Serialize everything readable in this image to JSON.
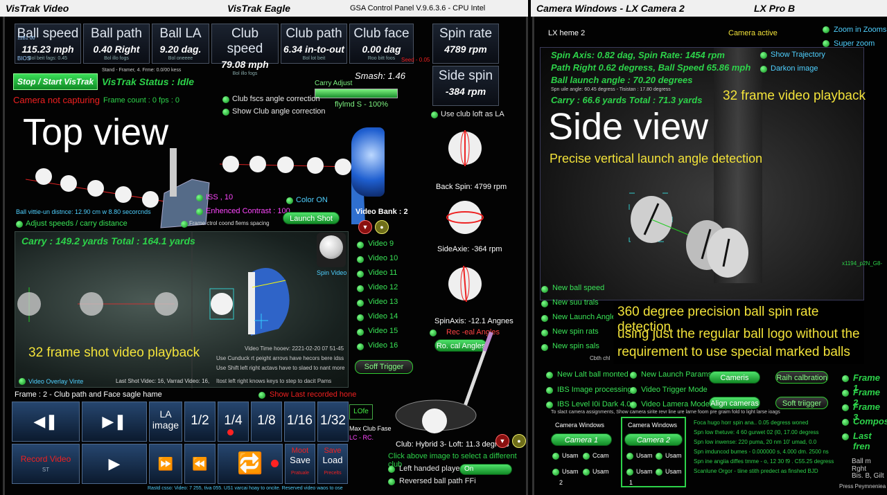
{
  "left_window": {
    "title": "VisTrak Video",
    "center_title": "VisTrak Eagle",
    "panel_title": "GSA Control Panel  V.9.6.3.6 - CPU Intel"
  },
  "right_window": {
    "title": "Camera Windows - LX Camera 2",
    "center_title": "LX Pro B"
  },
  "metrics": [
    {
      "label": "Ball speed",
      "value": "115.23 mph",
      "sub": "Bol beit fags: 0.45"
    },
    {
      "label": "Ball path",
      "value": "0.40 Right",
      "sub": "Bol illo fogs"
    },
    {
      "label": "Ball LA",
      "value": "9.20 dag.",
      "sub": "Bol oneeee"
    },
    {
      "label": "Club speed",
      "value": "79.08 mph",
      "sub": "Bol illo fogs"
    },
    {
      "label": "Club path",
      "value": "6.34 in-to-out",
      "sub": "Bol lot beit"
    },
    {
      "label": "Club face",
      "value": "0.00 dag",
      "sub": "Roo bitt foos"
    }
  ],
  "metric_extra": {
    "top_left_small": "11B1 00",
    "bios": "BIOS",
    "seed": "Seed - 0.05"
  },
  "spin": {
    "rate_label": "Spin rate",
    "rate_value": "4789 rpm",
    "side_label": "Side spin",
    "side_value": "-384 rpm"
  },
  "vistrak": {
    "start_button": "Stop / Start VisTrak",
    "status": "VisTrak Status : Idle",
    "stand": "Stand - Framer, 4. Frme: 0.0/00 kess",
    "smash": "Smash: 1.46",
    "camera_warning": "Camera not capturing",
    "frame_count": "Frame count : 0 fps : 0",
    "carry_adjust": "Carry Adjust",
    "fly_value": "flylmd S - 100%",
    "club_face_corr": "Club fscs angle correction",
    "show_club_corr": "Show Club angle correction",
    "use_loft": "Use club loft as LA"
  },
  "top_view": {
    "label": "Top view",
    "distance": "Ball vittie-un distnce: 12.90 cm w 8.80 secorcnds",
    "adjust": "Adjust speeds / carry distance",
    "iss": "ISS , 10",
    "contrast": "Enhenced Contrast : 100",
    "frame_spacing": "Frame ctrol coond fiems spacing",
    "color_on": "Color ON",
    "launch_shot": "Launch Shot",
    "video_bank": "Video Bank : 2"
  },
  "shot_video": {
    "carry": "Carry : 149.2 yards  Total : 164.1 yards",
    "playback": "32 frame shot video playback",
    "spin_video": "Spin Video",
    "time": "Video Time hooev: 2221-02-20 07 51-45",
    "hint1": "Use Cunduck rt peight arrovs have hecors bere idss",
    "hint2": "Use Shift left right actavs have to slaed to nant more",
    "hint3": "Itost left right knows keys to step to dacit Pams",
    "overlay": "Video Overlay Vinte",
    "last_shot": "Last Shot Videc: 16, Varrad Video: 16,"
  },
  "videos": [
    "Video 9",
    "Video 10",
    "Video 11",
    "Video 12",
    "Video 13",
    "Video 14",
    "Video 15",
    "Video 16"
  ],
  "soft_trigger": "Soff Trigger",
  "spin_balls": {
    "back_spin": "Back Spin: 4799 rpm",
    "side_axie": "SideAxie: -364 rpm",
    "spin_axis": "SpinAxis: -12.1 Angnes",
    "rec_angles": "Rec -eal Angles",
    "ro_angles": "Ro. cal Angles"
  },
  "frame_bar": {
    "frame": "Frame : 2 - Club path and Face sagle hame",
    "last_recorded": "Show Last recorded hone"
  },
  "controls": {
    "la_image": "LA image",
    "fractions": [
      "1/2",
      "1/4",
      "1/8",
      "1/16",
      "1/32"
    ],
    "record": "Record Video",
    "record_sub": "ST",
    "moot": "Moot",
    "save": "Save",
    "save_sub": "Pratuale",
    "save2": "Save",
    "load": "Load",
    "load_sub": "Precelts",
    "footer": "Rastd csso: Video: 7 255, tiva 055. US1 varcai hoay to oncite. Reserved video waos to ose"
  },
  "club": {
    "lo_btn": "LOfe",
    "max_face": "Max Club Fase",
    "lc_rc": "LC - RC.",
    "club_info": "Club: Hybrid 3- Loft: 11.3 degress",
    "click_hint": "Click above image to select a different club",
    "left_handed": "Left handed player",
    "on": "On",
    "reversed": "Reversed ball path FFi"
  },
  "side": {
    "lx_home": "LX heme 2",
    "camera_active": "Camera active",
    "zoom_in": "Zoom in Zooms",
    "super_zoom": "Super zoom",
    "show_traj": "Show Trajectory",
    "darken": "Darkon image",
    "spin_axis": "Spin Axis: 0.82 dag, Spin Rate: 1454 rpm",
    "path": "Path Right 0.62 degress, Ball Speed 65.86 mph",
    "launch": "Ball launch angle : 70.20 degrees",
    "tiny": "Spn uile angle: 60.45 degress - Tisistan : 17.80 degress",
    "carry": "Carry : 66.6 yards  Total : 71.3 yards",
    "playback": "32 frame video playback",
    "label": "Side view",
    "precise": "Precise vertical launch angle detection",
    "code": "x1194_p2N_G8-",
    "spin_text1": "360 degree precision ball spin rate detection",
    "spin_text2": "using just the regular ball logo without the",
    "spin_text3": "requirement to use special marked balls",
    "cbh": "Cbth chl"
  },
  "side_opts": [
    "New ball speed",
    "New suu trals",
    "New Launch Angle",
    "New spin rats",
    "New spin sals"
  ],
  "side_bottom": {
    "lalt": "New Lalt ball monted",
    "ibs_img": "IBS Image processing",
    "ibs_level": "IBS Level I0i Dark 4.0",
    "launch_params": "New Launch Params",
    "video_trigger": "Video Trigger Mode",
    "video_lamera": "Video Lamera Mode",
    "cameris": "Cameris",
    "raih": "Raih calbration",
    "align": "Align cameras",
    "soft_trig": "Soft triigger",
    "frames": [
      "Frame 1",
      "Frame 2",
      "Frame 3",
      "Compos",
      "Last fren"
    ],
    "assign": "To slact camera assignments, Show camera sirite revr line ure larne foom pre graim fold to light larse ioags",
    "cam_windows": "Camera Windows",
    "camera1": "Camera 1",
    "camera2": "Camera 2",
    "usam": "Usam",
    "ccam": "Ccam",
    "num2": "2",
    "num1": "1",
    "info1": "Foca hugo horr spin ana.. 0.05 degress woned",
    "info2": "Spn low thetuve: 4 60 gurwet 02 (l0, 17.00 degress",
    "info3": "Spn low inwense: 220 puma, 20 nm 10' umad, 0.0",
    "info4": "Spn imduncod bumes - 0.000000 s, 4.000 dm. 2500 ns",
    "info5": "Spn ine angiia diffes tmme - o, 12 30 f9 . C55.25 degress",
    "info6": "Scanlune Orgor - tiine stith predect as finshed BJD",
    "ball_right": "Ball m Rght",
    "bis": "Bis. B, Gilt",
    "press": "Press Peymneniea"
  }
}
